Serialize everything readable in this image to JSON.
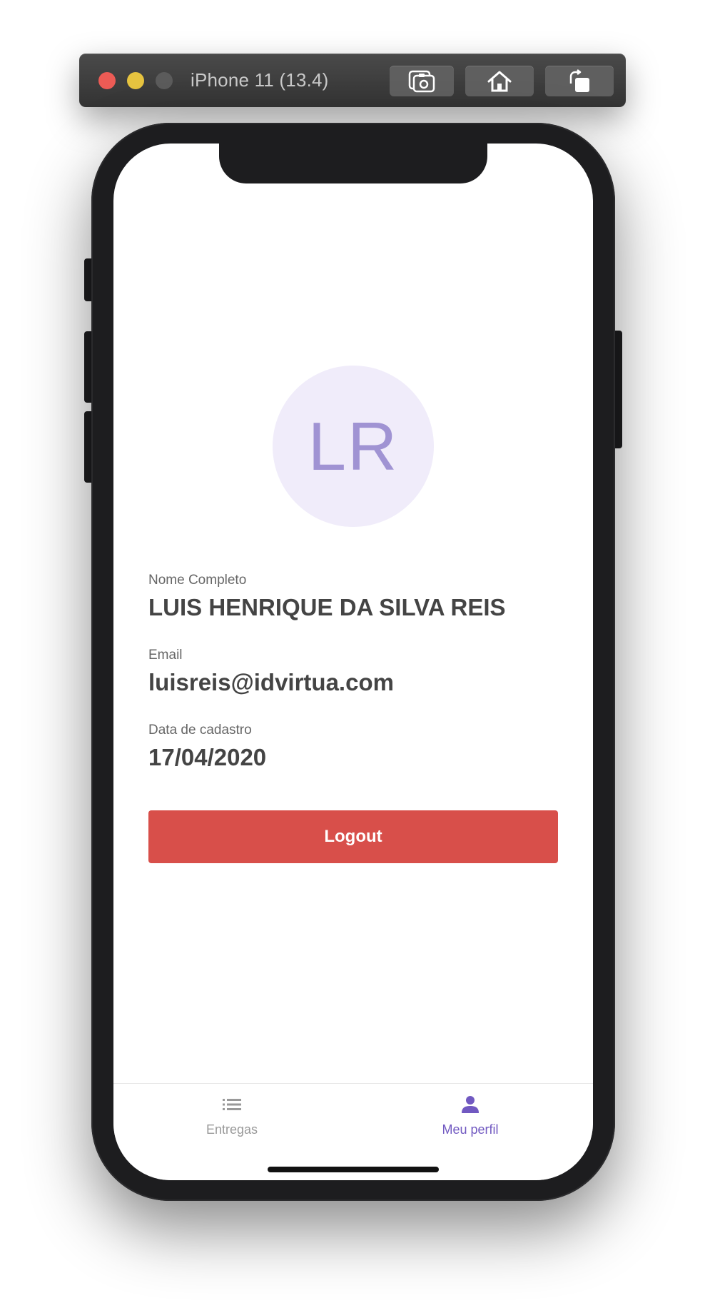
{
  "simulator": {
    "device_title": "iPhone 11 (13.4)",
    "buttons": [
      {
        "icon": "screenshot-icon"
      },
      {
        "icon": "home-icon"
      },
      {
        "icon": "rotate-icon"
      }
    ]
  },
  "profile": {
    "avatar_initials": "LR",
    "fields": [
      {
        "label": "Nome Completo",
        "value": "LUIS HENRIQUE DA SILVA REIS"
      },
      {
        "label": "Email",
        "value": "luisreis@idvirtua.com"
      },
      {
        "label": "Data de cadastro",
        "value": "17/04/2020"
      }
    ],
    "logout_label": "Logout"
  },
  "tabbar": {
    "tabs": [
      {
        "label": "Entregas",
        "icon": "list-icon",
        "active": false
      },
      {
        "label": "Meu perfil",
        "icon": "person-icon",
        "active": true
      }
    ]
  },
  "colors": {
    "accent": "#7159c1",
    "logout": "#d84f4a",
    "avatar_bg": "#f0ecfa",
    "avatar_text": "#a093d3"
  }
}
